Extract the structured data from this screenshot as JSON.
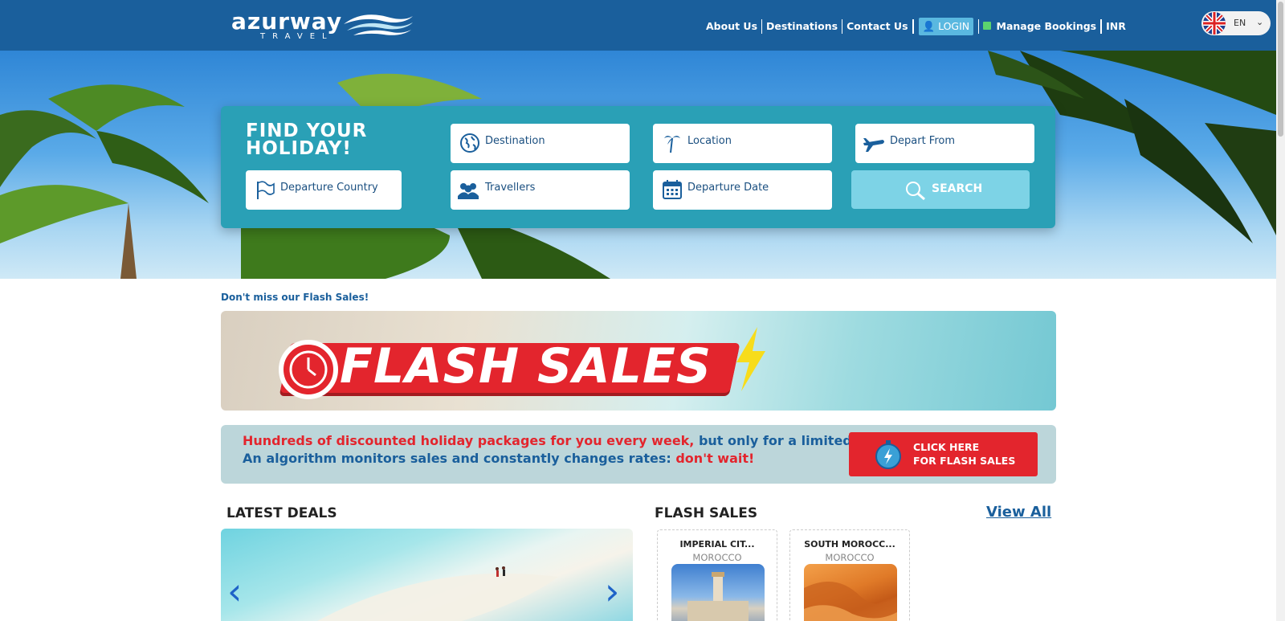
{
  "header": {
    "logo_text": "azurway",
    "logo_sub": "TRAVEL",
    "nav": {
      "about": "About Us",
      "destinations": "Destinations",
      "contact": "Contact Us",
      "login": "LOGIN",
      "manage": "Manage Bookings",
      "currency": "INR"
    },
    "language": "EN"
  },
  "search": {
    "title_line1": "FIND YOUR",
    "title_line2": "HOLIDAY!",
    "destination": "Destination",
    "location": "Location",
    "depart_from": "Depart From",
    "departure_country": "Departure Country",
    "travellers": "Travellers",
    "departure_date": "Departure Date",
    "search_button": "SEARCH"
  },
  "flash": {
    "heading": "Don't miss our Flash Sales!",
    "banner_text": "FLASH SALES",
    "promo_line1_red": "Hundreds of discounted holiday packages for you every week,",
    "promo_line1_blue": " but only for a limited period!",
    "promo_line2_blue": "An algorithm monitors sales and constantly changes rates:",
    "promo_line2_red": " don't wait!",
    "cta_line1": "CLICK HERE",
    "cta_line2": "FOR FLASH SALES"
  },
  "latest_deals": {
    "heading": "LATEST DEALS"
  },
  "flash_sales": {
    "heading": "FLASH SALES",
    "view_all": "View All",
    "cards": [
      {
        "title": "IMPERIAL CIT...",
        "country": "MOROCCO"
      },
      {
        "title": "SOUTH MOROCC...",
        "country": "MOROCCO"
      }
    ]
  },
  "colors": {
    "header_bg": "#1a5f9c",
    "search_panel": "#2aa0b6",
    "accent_red": "#e3252d",
    "link_blue": "#1a5f9c"
  }
}
